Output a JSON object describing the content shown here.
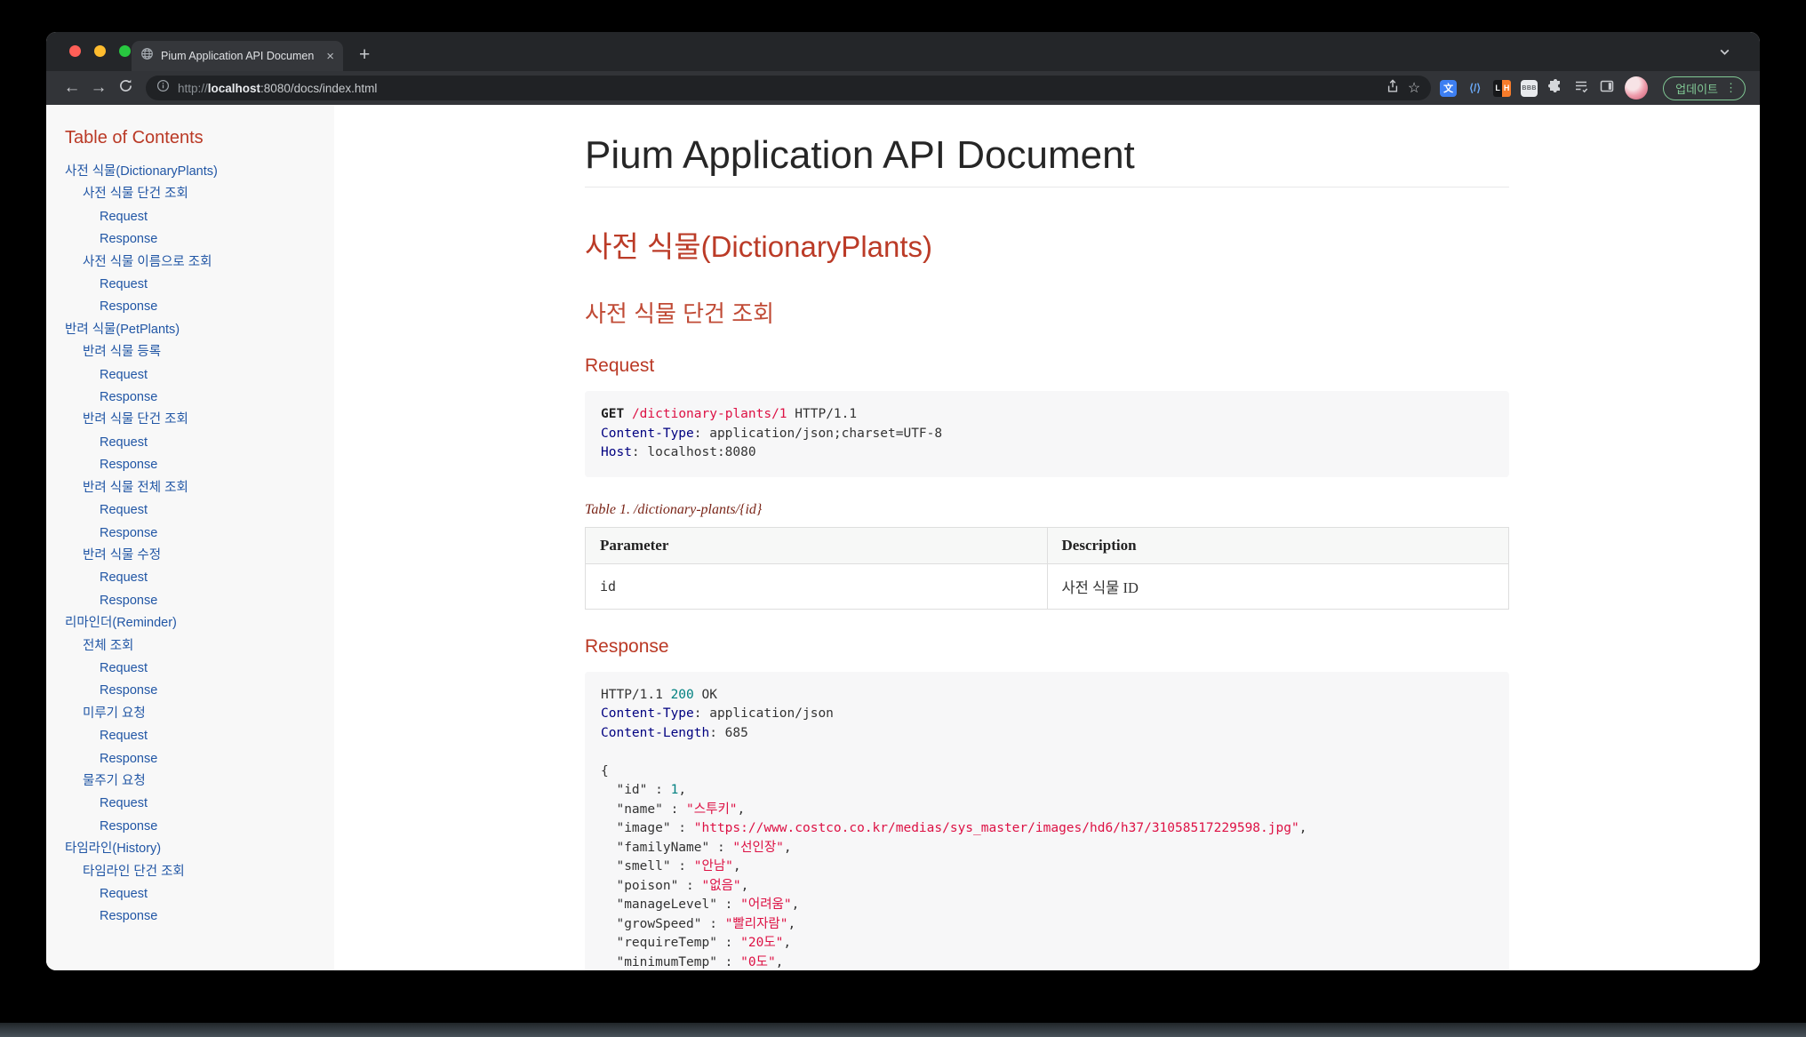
{
  "chrome": {
    "tab_title": "Pium Application API Documen",
    "url": {
      "scheme": "http://",
      "host": "localhost",
      "path": ":8080/docs/index.html"
    },
    "update_label": "업데이트",
    "icons": {
      "back": "←",
      "forward": "→",
      "star": "☆",
      "new_tab": "+",
      "close_tab": "×",
      "menu": "⋮",
      "translate_badge": "文",
      "devtools_badge": "⟨/⟩",
      "lh_left": "L",
      "lh_right": "H",
      "keyboard_badge": "BBB"
    },
    "colors": {
      "update_green": "#81c995",
      "traffic": [
        "#ff5f57",
        "#febc2e",
        "#28c840"
      ]
    }
  },
  "toc": {
    "title": "Table of Contents",
    "items": [
      {
        "label": "사전 식물(DictionaryPlants)",
        "level": 1
      },
      {
        "label": "사전 식물 단건 조회",
        "level": 2
      },
      {
        "label": "Request",
        "level": 3
      },
      {
        "label": "Response",
        "level": 3
      },
      {
        "label": "사전 식물 이름으로 조회",
        "level": 2
      },
      {
        "label": "Request",
        "level": 3
      },
      {
        "label": "Response",
        "level": 3
      },
      {
        "label": "반려 식물(PetPlants)",
        "level": 1
      },
      {
        "label": "반려 식물 등록",
        "level": 2
      },
      {
        "label": "Request",
        "level": 3
      },
      {
        "label": "Response",
        "level": 3
      },
      {
        "label": "반려 식물 단건 조회",
        "level": 2
      },
      {
        "label": "Request",
        "level": 3
      },
      {
        "label": "Response",
        "level": 3
      },
      {
        "label": "반려 식물 전체 조회",
        "level": 2
      },
      {
        "label": "Request",
        "level": 3
      },
      {
        "label": "Response",
        "level": 3
      },
      {
        "label": "반려 식물 수정",
        "level": 2
      },
      {
        "label": "Request",
        "level": 3
      },
      {
        "label": "Response",
        "level": 3
      },
      {
        "label": "리마인더(Reminder)",
        "level": 1
      },
      {
        "label": "전체 조회",
        "level": 2
      },
      {
        "label": "Request",
        "level": 3
      },
      {
        "label": "Response",
        "level": 3
      },
      {
        "label": "미루기 요청",
        "level": 2
      },
      {
        "label": "Request",
        "level": 3
      },
      {
        "label": "Response",
        "level": 3
      },
      {
        "label": "물주기 요청",
        "level": 2
      },
      {
        "label": "Request",
        "level": 3
      },
      {
        "label": "Response",
        "level": 3
      },
      {
        "label": "타임라인(History)",
        "level": 1
      },
      {
        "label": "타임라인 단건 조회",
        "level": 2
      },
      {
        "label": "Request",
        "level": 3
      },
      {
        "label": "Response",
        "level": 3
      }
    ]
  },
  "doc": {
    "title": "Pium Application API Document",
    "section": "사전 식물(DictionaryPlants)",
    "subsection": "사전 식물 단건 조회",
    "request_heading": "Request",
    "response_heading": "Response",
    "request": {
      "lines": [
        [
          [
            "b",
            "GET"
          ],
          [
            "p",
            " "
          ],
          [
            "s",
            "/dictionary-plants/1"
          ],
          [
            "p",
            " HTTP/1.1"
          ]
        ],
        [
          [
            "a",
            "Content-Type"
          ],
          [
            "p",
            ": application/json;charset=UTF-8"
          ]
        ],
        [
          [
            "a",
            "Host"
          ],
          [
            "p",
            ": localhost:8080"
          ]
        ]
      ]
    },
    "table": {
      "caption": "Table 1. /dictionary-plants/{id}",
      "headers": [
        "Parameter",
        "Description"
      ],
      "rows": [
        [
          "id",
          "사전 식물 ID"
        ]
      ]
    },
    "response": {
      "lines": [
        [
          [
            "p",
            "HTTP/1.1 "
          ],
          [
            "n",
            "200"
          ],
          [
            "p",
            " OK"
          ]
        ],
        [
          [
            "a",
            "Content-Type"
          ],
          [
            "p",
            ": application/json"
          ]
        ],
        [
          [
            "a",
            "Content-Length"
          ],
          [
            "p",
            ": 685"
          ]
        ],
        [],
        [
          [
            "p",
            "{"
          ]
        ],
        [
          [
            "p",
            "  \"id\" : "
          ],
          [
            "n",
            "1"
          ],
          [
            "p",
            ","
          ]
        ],
        [
          [
            "p",
            "  \"name\" : "
          ],
          [
            "s",
            "\"스투키\""
          ],
          [
            "p",
            ","
          ]
        ],
        [
          [
            "p",
            "  \"image\" : "
          ],
          [
            "s",
            "\"https://www.costco.co.kr/medias/sys_master/images/hd6/h37/31058517229598.jpg\""
          ],
          [
            "p",
            ","
          ]
        ],
        [
          [
            "p",
            "  \"familyName\" : "
          ],
          [
            "s",
            "\"선인장\""
          ],
          [
            "p",
            ","
          ]
        ],
        [
          [
            "p",
            "  \"smell\" : "
          ],
          [
            "s",
            "\"안남\""
          ],
          [
            "p",
            ","
          ]
        ],
        [
          [
            "p",
            "  \"poison\" : "
          ],
          [
            "s",
            "\"없음\""
          ],
          [
            "p",
            ","
          ]
        ],
        [
          [
            "p",
            "  \"manageLevel\" : "
          ],
          [
            "s",
            "\"어려움\""
          ],
          [
            "p",
            ","
          ]
        ],
        [
          [
            "p",
            "  \"growSpeed\" : "
          ],
          [
            "s",
            "\"빨리자람\""
          ],
          [
            "p",
            ","
          ]
        ],
        [
          [
            "p",
            "  \"requireTemp\" : "
          ],
          [
            "s",
            "\"20도\""
          ],
          [
            "p",
            ","
          ]
        ],
        [
          [
            "p",
            "  \"minimumTemp\" : "
          ],
          [
            "s",
            "\"0도\""
          ],
          [
            "p",
            ","
          ]
        ]
      ]
    },
    "colors": {
      "heading_red": "#ba3925",
      "caption_maroon": "#7a2518",
      "link_blue": "#2156a5",
      "code_string": "#dd1144",
      "code_number": "#008080",
      "code_attr": "#000080",
      "code_bg": "#f7f7f8",
      "toc_bg": "#f8f8f8"
    }
  }
}
